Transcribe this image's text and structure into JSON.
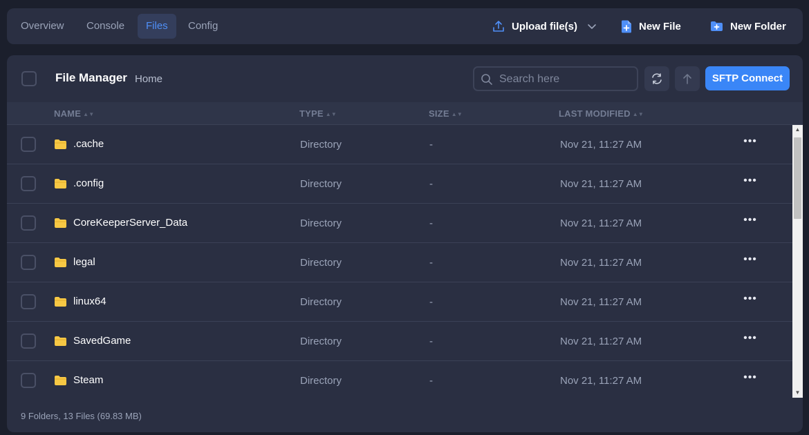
{
  "nav": {
    "tabs": [
      {
        "label": "Overview",
        "active": false
      },
      {
        "label": "Console",
        "active": false
      },
      {
        "label": "Files",
        "active": true
      },
      {
        "label": "Config",
        "active": false
      }
    ],
    "actions": {
      "upload_label": "Upload file(s)",
      "new_file_label": "New File",
      "new_folder_label": "New Folder"
    }
  },
  "file_manager": {
    "title": "File Manager",
    "breadcrumb": "Home",
    "search_placeholder": "Search here",
    "sftp_label": "SFTP Connect",
    "columns": {
      "name": "NAME",
      "type": "TYPE",
      "size": "SIZE",
      "modified": "LAST MODIFIED"
    },
    "rows": [
      {
        "name": ".cache",
        "type": "Directory",
        "size": "-",
        "modified": "Nov 21, 11:27 AM"
      },
      {
        "name": ".config",
        "type": "Directory",
        "size": "-",
        "modified": "Nov 21, 11:27 AM"
      },
      {
        "name": "CoreKeeperServer_Data",
        "type": "Directory",
        "size": "-",
        "modified": "Nov 21, 11:27 AM"
      },
      {
        "name": "legal",
        "type": "Directory",
        "size": "-",
        "modified": "Nov 21, 11:27 AM"
      },
      {
        "name": "linux64",
        "type": "Directory",
        "size": "-",
        "modified": "Nov 21, 11:27 AM"
      },
      {
        "name": "SavedGame",
        "type": "Directory",
        "size": "-",
        "modified": "Nov 21, 11:27 AM"
      },
      {
        "name": "Steam",
        "type": "Directory",
        "size": "-",
        "modified": "Nov 21, 11:27 AM"
      }
    ],
    "summary": "9 Folders, 13 Files (69.83 MB)"
  },
  "colors": {
    "accent": "#3a86f7",
    "folder": "#f7c844",
    "panel": "#2a2f42",
    "background": "#1b1f2c"
  },
  "icons": {
    "upload": "upload-icon",
    "new_file": "file-plus-icon",
    "new_folder": "folder-plus-icon",
    "search": "search-icon",
    "refresh": "refresh-icon",
    "up": "arrow-up-icon",
    "row_folder": "folder-icon",
    "row_menu": "ellipsis-icon"
  }
}
